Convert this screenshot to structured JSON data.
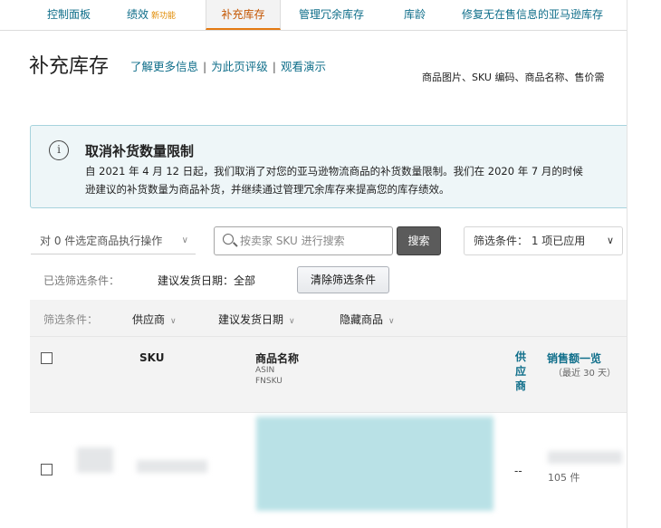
{
  "tabs": [
    {
      "label": "控制面板"
    },
    {
      "label": "绩效",
      "badge": "新功能"
    },
    {
      "label": "补充库存"
    },
    {
      "label": "管理冗余库存"
    },
    {
      "label": "库龄"
    },
    {
      "label": "修复无在售信息的亚马逊库存"
    }
  ],
  "page": {
    "title": "补充库存",
    "links": [
      "了解更多信息",
      "为此页评级",
      "观看演示"
    ],
    "column_hint": "商品图片、SKU 编码、商品名称、售价需"
  },
  "info": {
    "title": "取消补货数量限制",
    "line1": "自 2021 年 4 月 12 日起，我们取消了对您的亚马逊物流商品的补货数量限制。我们在 2020 年 7 月的时候",
    "line2": "逊建议的补货数量为商品补货，并继续通过管理冗余库存来提高您的库存绩效。"
  },
  "toolbar": {
    "bulk_action": "对 0 件选定商品执行操作",
    "search_placeholder": "按卖家 SKU 进行搜索",
    "search_button": "搜索",
    "filter_status": "筛选条件：  1 项已应用"
  },
  "applied_filters": {
    "label": "已选筛选条件：",
    "value": "建议发货日期：全部",
    "clear_button": "清除筛选条件"
  },
  "filterbar": {
    "label": "筛选条件：",
    "dropdowns": [
      "供应商",
      "建议发货日期",
      "隐藏商品"
    ]
  },
  "table": {
    "headers": {
      "sku": "SKU",
      "name": "商品名称",
      "name_sub1": "ASIN",
      "name_sub2": "FNSKU",
      "supplier": "供应商",
      "sales": "销售额一览",
      "sales_sub": "（最近 30 天）"
    },
    "rows": [
      {
        "supplier": "--",
        "units": "105 件"
      }
    ]
  }
}
